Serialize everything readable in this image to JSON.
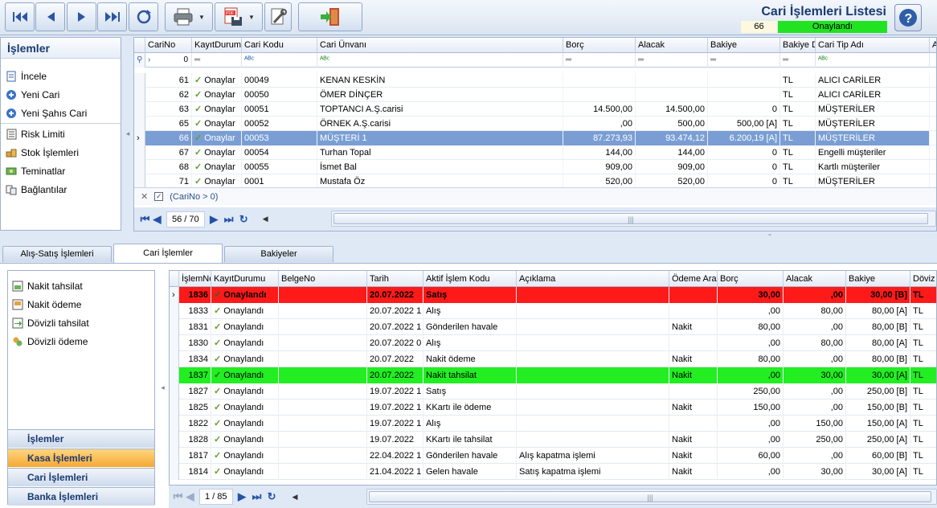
{
  "toolbar": {
    "title": "Cari İşlemleri Listesi",
    "record_count": "66",
    "status": "Onaylandı"
  },
  "left_panel": {
    "header": "İşlemler",
    "items": [
      {
        "label": "İncele",
        "icon": "document-icon"
      },
      {
        "label": "Yeni Cari",
        "icon": "plus-circle-icon"
      },
      {
        "label": "Yeni Şahıs Cari",
        "icon": "plus-circle-icon"
      },
      {
        "label": "Risk Limiti",
        "icon": "list-icon"
      },
      {
        "label": "Stok İşlemleri",
        "icon": "boxes-icon"
      },
      {
        "label": "Teminatlar",
        "icon": "money-icon"
      },
      {
        "label": "Bağlantılar",
        "icon": "link-icon"
      }
    ]
  },
  "top_grid": {
    "columns": [
      "CariNo",
      "KayıtDurumu",
      "Cari Kodu",
      "Cari Ünvanı",
      "Borç",
      "Alacak",
      "Bakiye",
      "Bakiye D",
      "Cari Tip Adı",
      "Al"
    ],
    "filter_row": {
      "carino": "0"
    },
    "rows": [
      {
        "no": "61",
        "status": "Onaylar",
        "code": "00049",
        "name": "KENAN KESKİN",
        "borc": "",
        "alacak": "",
        "bakiye": "",
        "doviz": "TL",
        "tip": "ALICI CARİLER"
      },
      {
        "no": "62",
        "status": "Onaylar",
        "code": "00050",
        "name": "ÖMER DİNÇER",
        "borc": "",
        "alacak": "",
        "bakiye": "",
        "doviz": "TL",
        "tip": "ALICI CARİLER"
      },
      {
        "no": "63",
        "status": "Onaylar",
        "code": "00051",
        "name": "TOPTANCI A.Ş.carisi",
        "borc": "14.500,00",
        "alacak": "14.500,00",
        "bakiye": "0",
        "doviz": "TL",
        "tip": "MÜŞTERİLER"
      },
      {
        "no": "65",
        "status": "Onaylar",
        "code": "00052",
        "name": "ÖRNEK A.Ş.carisi",
        "borc": ",00",
        "alacak": "500,00",
        "bakiye": "500,00 [A]",
        "doviz": "TL",
        "tip": "MÜŞTERİLER"
      },
      {
        "no": "66",
        "status": "Onaylar",
        "code": "00053",
        "name": "MÜŞTERİ 1",
        "borc": "87.273,93",
        "alacak": "93.474,12",
        "bakiye": "6.200,19 [A]",
        "doviz": "TL",
        "tip": "MÜŞTERİLER",
        "selected": true
      },
      {
        "no": "67",
        "status": "Onaylar",
        "code": "00054",
        "name": "Turhan Topal",
        "borc": "144,00",
        "alacak": "144,00",
        "bakiye": "0",
        "doviz": "TL",
        "tip": "Engelli müşteriler"
      },
      {
        "no": "68",
        "status": "Onaylar",
        "code": "00055",
        "name": "İsmet Bal",
        "borc": "909,00",
        "alacak": "909,00",
        "bakiye": "0",
        "doviz": "TL",
        "tip": "Kartlı müşteriler"
      },
      {
        "no": "71",
        "status": "Onaylar",
        "code": "0001",
        "name": "Mustafa Öz",
        "borc": "520,00",
        "alacak": "520,00",
        "bakiye": "0",
        "doviz": "TL",
        "tip": "MÜŞTERİLER"
      }
    ],
    "filter_text": "(CariNo > 0)",
    "pager": "56 / 70"
  },
  "tabs": [
    "Alış-Satış İşlemleri",
    "Cari İşlemler",
    "Bakiyeler"
  ],
  "bottom_left": {
    "items": [
      {
        "label": "Nakit tahsilat",
        "icon": "cash-in-icon"
      },
      {
        "label": "Nakit ödeme",
        "icon": "cash-out-icon"
      },
      {
        "label": "Dövizli tahsilat",
        "icon": "currency-in-icon"
      },
      {
        "label": "Dövizli ödeme",
        "icon": "currency-out-icon"
      }
    ],
    "groups": [
      "İşlemler",
      "Kasa İşlemleri",
      "Cari İşlemleri",
      "Banka İşlemleri"
    ]
  },
  "bottom_grid": {
    "columns": [
      "İşlemNo",
      "KayıtDurumu",
      "BelgeNo",
      "Tarih",
      "Aktif İşlem Kodu",
      "Açıklama",
      "Ödeme Ara",
      "Borç",
      "Alacak",
      "Bakiye",
      "Döviz"
    ],
    "rows": [
      {
        "no": "1836",
        "status": "Onaylandı",
        "belge": "",
        "tarih": "20.07.2022",
        "kod": "Satış",
        "aciklama": "",
        "odeme": "",
        "borc": "30,00",
        "alacak": ",00",
        "bakiye": "30,00 [B]",
        "doviz": "TL",
        "style": "red"
      },
      {
        "no": "1833",
        "status": "Onaylandı",
        "belge": "",
        "tarih": "20.07.2022 1",
        "kod": "Alış",
        "aciklama": "",
        "odeme": "",
        "borc": ",00",
        "alacak": "80,00",
        "bakiye": "80,00 [A]",
        "doviz": "TL"
      },
      {
        "no": "1831",
        "status": "Onaylandı",
        "belge": "",
        "tarih": "20.07.2022 1",
        "kod": "Gönderilen havale",
        "aciklama": "",
        "odeme": "Nakit",
        "borc": "80,00",
        "alacak": ",00",
        "bakiye": "80,00 [B]",
        "doviz": "TL"
      },
      {
        "no": "1830",
        "status": "Onaylandı",
        "belge": "",
        "tarih": "20.07.2022 0",
        "kod": "Alış",
        "aciklama": "",
        "odeme": "",
        "borc": ",00",
        "alacak": "80,00",
        "bakiye": "80,00 [A]",
        "doviz": "TL"
      },
      {
        "no": "1834",
        "status": "Onaylandı",
        "belge": "",
        "tarih": "20.07.2022",
        "kod": "Nakit ödeme",
        "aciklama": "",
        "odeme": "Nakit",
        "borc": "80,00",
        "alacak": ",00",
        "bakiye": "80,00 [B]",
        "doviz": "TL"
      },
      {
        "no": "1837",
        "status": "Onaylandı",
        "belge": "",
        "tarih": "20.07.2022",
        "kod": "Nakit tahsilat",
        "aciklama": "",
        "odeme": "Nakit",
        "borc": ",00",
        "alacak": "30,00",
        "bakiye": "30,00 [A]",
        "doviz": "TL",
        "style": "green"
      },
      {
        "no": "1827",
        "status": "Onaylandı",
        "belge": "",
        "tarih": "19.07.2022 1",
        "kod": "Satış",
        "aciklama": "",
        "odeme": "",
        "borc": "250,00",
        "alacak": ",00",
        "bakiye": "250,00 [B]",
        "doviz": "TL"
      },
      {
        "no": "1825",
        "status": "Onaylandı",
        "belge": "",
        "tarih": "19.07.2022 1",
        "kod": "KKartı ile ödeme",
        "aciklama": "",
        "odeme": "Nakit",
        "borc": "150,00",
        "alacak": ",00",
        "bakiye": "150,00 [B]",
        "doviz": "TL"
      },
      {
        "no": "1822",
        "status": "Onaylandı",
        "belge": "",
        "tarih": "19.07.2022 1",
        "kod": "Alış",
        "aciklama": "",
        "odeme": "",
        "borc": ",00",
        "alacak": "150,00",
        "bakiye": "150,00 [A]",
        "doviz": "TL"
      },
      {
        "no": "1828",
        "status": "Onaylandı",
        "belge": "",
        "tarih": "19.07.2022",
        "kod": "KKartı ile tahsilat",
        "aciklama": "",
        "odeme": "Nakit",
        "borc": ",00",
        "alacak": "250,00",
        "bakiye": "250,00 [A]",
        "doviz": "TL"
      },
      {
        "no": "1817",
        "status": "Onaylandı",
        "belge": "",
        "tarih": "22.04.2022 1",
        "kod": "Gönderilen havale",
        "aciklama": "Alış kapatma işlemi",
        "odeme": "Nakit",
        "borc": "60,00",
        "alacak": ",00",
        "bakiye": "60,00 [B]",
        "doviz": "TL"
      },
      {
        "no": "1814",
        "status": "Onaylandı",
        "belge": "",
        "tarih": "21.04.2022 1",
        "kod": "Gelen havale",
        "aciklama": "Satış kapatma işlemi",
        "odeme": "Nakit",
        "borc": ",00",
        "alacak": "30,00",
        "bakiye": "30,00 [A]",
        "doviz": "TL"
      }
    ],
    "pager": "1 / 85"
  }
}
